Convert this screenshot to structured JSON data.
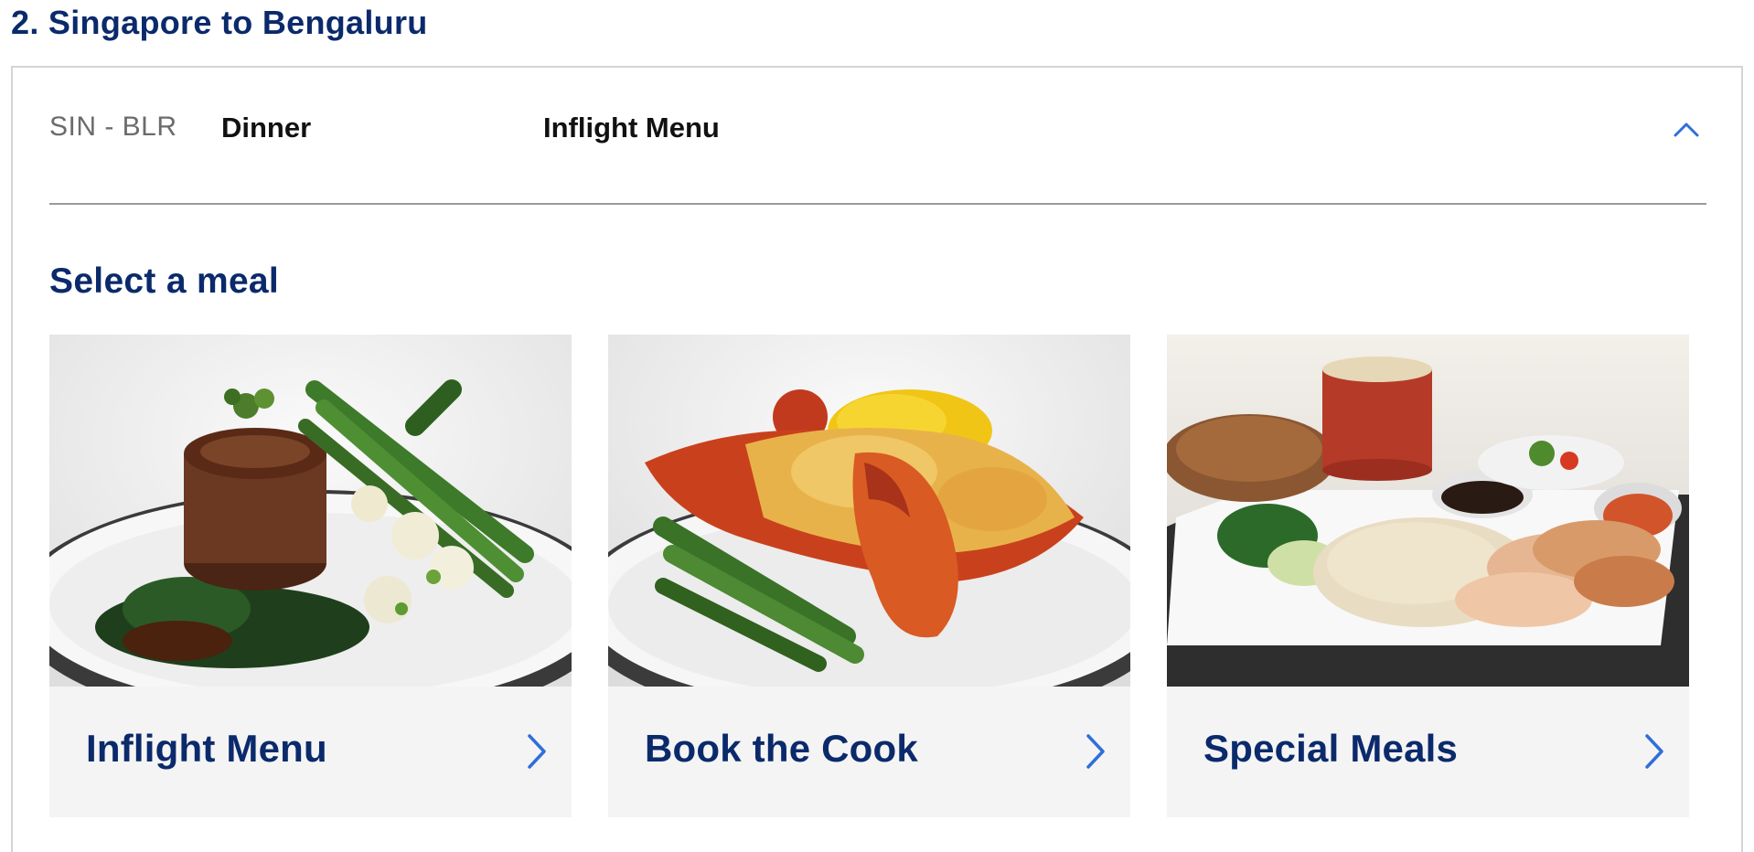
{
  "heading": "2. Singapore to Bengaluru",
  "leg": {
    "route": "SIN - BLR",
    "meal": "Dinner",
    "menu": "Inflight Menu"
  },
  "section_title": "Select a meal",
  "cards": [
    {
      "label": "Inflight Menu",
      "image": "beef-fillet-dish"
    },
    {
      "label": "Book the Cook",
      "image": "lobster-thermidor-dish"
    },
    {
      "label": "Special Meals",
      "image": "chicken-rice-tray"
    }
  ],
  "colors": {
    "heading": "#0b2a6b",
    "accent": "#2f6fd8",
    "card_footer": "#f4f4f4"
  },
  "icons": {
    "collapse": "chevron-up-icon",
    "card_arrow": "chevron-right-icon"
  }
}
